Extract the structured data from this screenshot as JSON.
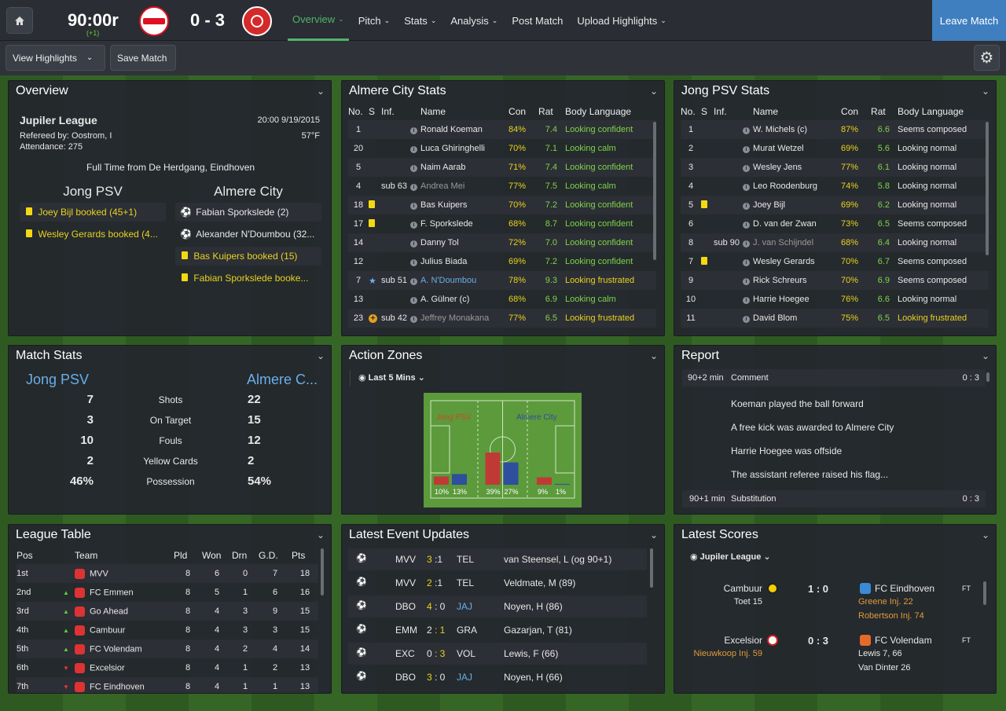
{
  "topbar": {
    "clock": "90:00r",
    "clock_sub": "(+1)",
    "score": "0 - 3",
    "nav": [
      {
        "label": "Overview"
      },
      {
        "label": "Pitch"
      },
      {
        "label": "Stats"
      },
      {
        "label": "Analysis"
      },
      {
        "label": "Post Match"
      },
      {
        "label": "Upload Highlights"
      }
    ],
    "leave": "Leave Match"
  },
  "toolbar": {
    "view_highlights": "View Highlights",
    "save_match": "Save Match"
  },
  "overview": {
    "title": "Overview",
    "league": "Jupiler League",
    "datetime": "20:00 9/19/2015",
    "referee": "Refereed by: Oostrom, I",
    "temp": "57°F",
    "attendance": "Attendance: 275",
    "fulltime": "Full Time from De Herdgang, Eindhoven",
    "home": "Jong PSV",
    "away": "Almere City",
    "home_events": [
      "Joey Bijl booked (45+1)",
      "Wesley Gerards booked (4..."
    ],
    "away_events": [
      {
        "icon": "ball",
        "text": "Fabian Sporkslede (2)"
      },
      {
        "icon": "ball",
        "text": "Alexander N'Doumbou (32..."
      },
      {
        "icon": "card",
        "text": "Bas Kuipers booked (15)"
      },
      {
        "icon": "card",
        "text": "Fabian Sporkslede booke..."
      }
    ]
  },
  "almere": {
    "title": "Almere City Stats",
    "headers": [
      "No.",
      "S",
      "Inf.",
      "Name",
      "Con",
      "Rat",
      "Body Language"
    ],
    "rows": [
      {
        "no": "1",
        "s": "",
        "inf": "",
        "name": "Ronald Koeman",
        "con": "84%",
        "rat": "7.4",
        "bl": "Looking confident"
      },
      {
        "no": "20",
        "s": "",
        "inf": "",
        "name": "Luca Ghiringhelli",
        "con": "70%",
        "rat": "7.1",
        "bl": "Looking calm"
      },
      {
        "no": "5",
        "s": "",
        "inf": "",
        "name": "Naim Aarab",
        "con": "71%",
        "rat": "7.4",
        "bl": "Looking confident"
      },
      {
        "no": "4",
        "s": "",
        "inf": "sub 63",
        "name": "Andrea Mei",
        "con": "77%",
        "rat": "7.5",
        "bl": "Looking calm"
      },
      {
        "no": "18",
        "s": "card",
        "inf": "",
        "name": "Bas Kuipers",
        "con": "70%",
        "rat": "7.2",
        "bl": "Looking confident"
      },
      {
        "no": "17",
        "s": "card",
        "inf": "",
        "name": "F. Sporkslede",
        "con": "68%",
        "rat": "8.7",
        "bl": "Looking confident"
      },
      {
        "no": "14",
        "s": "",
        "inf": "",
        "name": "Danny Tol",
        "con": "72%",
        "rat": "7.0",
        "bl": "Looking confident"
      },
      {
        "no": "12",
        "s": "",
        "inf": "",
        "name": "Julius Biada",
        "con": "69%",
        "rat": "7.2",
        "bl": "Looking confident"
      },
      {
        "no": "7",
        "s": "star",
        "inf": "sub 51",
        "name": "A. N'Doumbou",
        "con": "78%",
        "rat": "9.3",
        "bl": "Looking frustrated"
      },
      {
        "no": "13",
        "s": "",
        "inf": "",
        "name": "A. Gülner (c)",
        "con": "68%",
        "rat": "6.9",
        "bl": "Looking calm"
      },
      {
        "no": "23",
        "s": "plus",
        "inf": "sub 42",
        "name": "Jeffrey Monakana",
        "con": "77%",
        "rat": "6.5",
        "bl": "Looking frustrated"
      }
    ]
  },
  "jong": {
    "title": "Jong PSV Stats",
    "headers": [
      "No.",
      "S",
      "Inf.",
      "Name",
      "Con",
      "Rat",
      "Body Language"
    ],
    "rows": [
      {
        "no": "1",
        "s": "",
        "inf": "",
        "name": "W. Michels (c)",
        "con": "87%",
        "rat": "6.6",
        "bl": "Seems composed"
      },
      {
        "no": "2",
        "s": "",
        "inf": "",
        "name": "Murat Wetzel",
        "con": "69%",
        "rat": "5.6",
        "bl": "Looking normal"
      },
      {
        "no": "3",
        "s": "",
        "inf": "",
        "name": "Wesley Jens",
        "con": "77%",
        "rat": "6.1",
        "bl": "Looking normal"
      },
      {
        "no": "4",
        "s": "",
        "inf": "",
        "name": "Leo Roodenburg",
        "con": "74%",
        "rat": "5.8",
        "bl": "Looking normal"
      },
      {
        "no": "5",
        "s": "card",
        "inf": "",
        "name": "Joey Bijl",
        "con": "69%",
        "rat": "6.2",
        "bl": "Looking normal"
      },
      {
        "no": "6",
        "s": "",
        "inf": "",
        "name": "D. van der Zwan",
        "con": "73%",
        "rat": "6.5",
        "bl": "Seems composed"
      },
      {
        "no": "8",
        "s": "",
        "inf": "sub 90",
        "name": "J. van Schijndel",
        "con": "68%",
        "rat": "6.4",
        "bl": "Looking normal"
      },
      {
        "no": "7",
        "s": "card",
        "inf": "",
        "name": "Wesley Gerards",
        "con": "70%",
        "rat": "6.7",
        "bl": "Seems composed"
      },
      {
        "no": "9",
        "s": "",
        "inf": "",
        "name": "Rick Schreurs",
        "con": "70%",
        "rat": "6.9",
        "bl": "Seems composed"
      },
      {
        "no": "10",
        "s": "",
        "inf": "",
        "name": "Harrie Hoegee",
        "con": "76%",
        "rat": "6.6",
        "bl": "Looking normal"
      },
      {
        "no": "11",
        "s": "",
        "inf": "",
        "name": "David Blom",
        "con": "75%",
        "rat": "6.5",
        "bl": "Looking frustrated"
      }
    ]
  },
  "matchstats": {
    "title": "Match Stats",
    "home": "Jong PSV",
    "away": "Almere C...",
    "rows": [
      {
        "label": "Shots",
        "home": "7",
        "away": "22"
      },
      {
        "label": "On Target",
        "home": "3",
        "away": "15"
      },
      {
        "label": "Fouls",
        "home": "10",
        "away": "12"
      },
      {
        "label": "Yellow Cards",
        "home": "2",
        "away": "2"
      },
      {
        "label": "Possession",
        "home": "46%",
        "away": "54%"
      }
    ]
  },
  "actionzones": {
    "title": "Action Zones",
    "filter": "Last 5 Mins",
    "home": "Jong PSV",
    "away": "Almere City",
    "zones": [
      {
        "home": 10,
        "away": 13,
        "home_label": "10%",
        "away_label": "13%"
      },
      {
        "home": 39,
        "away": 27,
        "home_label": "39%",
        "away_label": "27%"
      },
      {
        "home": 9,
        "away": 1,
        "home_label": "9%",
        "away_label": "1%"
      }
    ]
  },
  "report": {
    "title": "Report",
    "head1": {
      "time": "90+2 min",
      "type": "Comment",
      "score": "0 : 3"
    },
    "lines": [
      "Koeman played the ball forward",
      "A free kick was awarded to Almere City",
      "Harrie Hoegee was offside",
      "The assistant referee raised his flag..."
    ],
    "head2": {
      "time": "90+1 min",
      "type": "Substitution",
      "score": "0 : 3"
    }
  },
  "league": {
    "title": "League Table",
    "headers": [
      "Pos",
      "Team",
      "Pld",
      "Won",
      "Drn",
      "G.D.",
      "Pts"
    ],
    "rows": [
      {
        "pos": "1st",
        "team": "MVV",
        "pld": "8",
        "won": "6",
        "drn": "0",
        "gd": "7",
        "pts": "18",
        "move": ""
      },
      {
        "pos": "2nd",
        "team": "FC Emmen",
        "pld": "8",
        "won": "5",
        "drn": "1",
        "gd": "6",
        "pts": "16",
        "move": "up"
      },
      {
        "pos": "3rd",
        "team": "Go Ahead",
        "pld": "8",
        "won": "4",
        "drn": "3",
        "gd": "9",
        "pts": "15",
        "move": "up"
      },
      {
        "pos": "4th",
        "team": "Cambuur",
        "pld": "8",
        "won": "4",
        "drn": "3",
        "gd": "3",
        "pts": "15",
        "move": "up"
      },
      {
        "pos": "5th",
        "team": "FC Volendam",
        "pld": "8",
        "won": "4",
        "drn": "2",
        "gd": "4",
        "pts": "14",
        "move": "up"
      },
      {
        "pos": "6th",
        "team": "Excelsior",
        "pld": "8",
        "won": "4",
        "drn": "1",
        "gd": "2",
        "pts": "13",
        "move": "down"
      },
      {
        "pos": "7th",
        "team": "FC Eindhoven",
        "pld": "8",
        "won": "4",
        "drn": "1",
        "gd": "1",
        "pts": "13",
        "move": "down"
      }
    ]
  },
  "events": {
    "title": "Latest Event Updates",
    "rows": [
      {
        "icon": "own",
        "home": "MVV",
        "hs": "3",
        "as": ":1",
        "away": "TEL",
        "text": "van Steensel, L (og 90+1)",
        "hl": "home"
      },
      {
        "icon": "ball",
        "home": "MVV",
        "hs": "2",
        "as": ":1",
        "away": "TEL",
        "text": "Veldmate, M (89)",
        "hl": "home"
      },
      {
        "icon": "ball",
        "home": "DBO",
        "hs": "4",
        "as": ": 0",
        "away": "JAJ",
        "text": "Noyen, H (86)",
        "hl": "home"
      },
      {
        "icon": "ball",
        "home": "EMM",
        "hs": "2",
        "as": ": 1",
        "away": "GRA",
        "text": "Gazarjan, T (81)",
        "hl": "away"
      },
      {
        "icon": "ball",
        "home": "EXC",
        "hs": "0",
        "as": ": 3",
        "away": "VOL",
        "text": "Lewis, F (66)",
        "hl": "away"
      },
      {
        "icon": "ball",
        "home": "DBO",
        "hs": "3",
        "as": ": 0",
        "away": "JAJ",
        "text": "Noyen, H (66)",
        "hl": "home"
      }
    ]
  },
  "scores": {
    "title": "Latest Scores",
    "filter": "Jupiler League",
    "matches": [
      {
        "home": "Cambuur",
        "score": "1 : 0",
        "away": "FC Eindhoven",
        "status": "FT",
        "home_lines": [
          "Toet 15"
        ],
        "away_lines": [
          "Greene Inj. 22",
          "Robertson Inj. 74"
        ]
      },
      {
        "home": "Excelsior",
        "score": "0 : 3",
        "away": "FC Volendam",
        "status": "FT",
        "home_lines": [
          "Nieuwkoop Inj. 59"
        ],
        "away_lines": [
          "Lewis 7, 66",
          "Van Dinter 26"
        ]
      }
    ]
  }
}
